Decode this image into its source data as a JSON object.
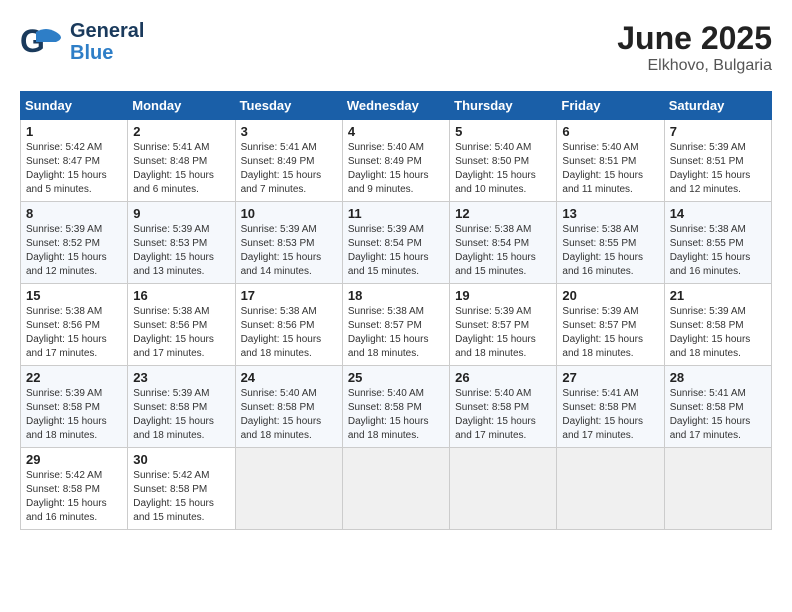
{
  "header": {
    "logo_general": "General",
    "logo_blue": "Blue",
    "month_year": "June 2025",
    "location": "Elkhovo, Bulgaria"
  },
  "calendar": {
    "days_of_week": [
      "Sunday",
      "Monday",
      "Tuesday",
      "Wednesday",
      "Thursday",
      "Friday",
      "Saturday"
    ],
    "weeks": [
      [
        {
          "day": "1",
          "info": "Sunrise: 5:42 AM\nSunset: 8:47 PM\nDaylight: 15 hours\nand 5 minutes."
        },
        {
          "day": "2",
          "info": "Sunrise: 5:41 AM\nSunset: 8:48 PM\nDaylight: 15 hours\nand 6 minutes."
        },
        {
          "day": "3",
          "info": "Sunrise: 5:41 AM\nSunset: 8:49 PM\nDaylight: 15 hours\nand 7 minutes."
        },
        {
          "day": "4",
          "info": "Sunrise: 5:40 AM\nSunset: 8:49 PM\nDaylight: 15 hours\nand 9 minutes."
        },
        {
          "day": "5",
          "info": "Sunrise: 5:40 AM\nSunset: 8:50 PM\nDaylight: 15 hours\nand 10 minutes."
        },
        {
          "day": "6",
          "info": "Sunrise: 5:40 AM\nSunset: 8:51 PM\nDaylight: 15 hours\nand 11 minutes."
        },
        {
          "day": "7",
          "info": "Sunrise: 5:39 AM\nSunset: 8:51 PM\nDaylight: 15 hours\nand 12 minutes."
        }
      ],
      [
        {
          "day": "8",
          "info": "Sunrise: 5:39 AM\nSunset: 8:52 PM\nDaylight: 15 hours\nand 12 minutes."
        },
        {
          "day": "9",
          "info": "Sunrise: 5:39 AM\nSunset: 8:53 PM\nDaylight: 15 hours\nand 13 minutes."
        },
        {
          "day": "10",
          "info": "Sunrise: 5:39 AM\nSunset: 8:53 PM\nDaylight: 15 hours\nand 14 minutes."
        },
        {
          "day": "11",
          "info": "Sunrise: 5:39 AM\nSunset: 8:54 PM\nDaylight: 15 hours\nand 15 minutes."
        },
        {
          "day": "12",
          "info": "Sunrise: 5:38 AM\nSunset: 8:54 PM\nDaylight: 15 hours\nand 15 minutes."
        },
        {
          "day": "13",
          "info": "Sunrise: 5:38 AM\nSunset: 8:55 PM\nDaylight: 15 hours\nand 16 minutes."
        },
        {
          "day": "14",
          "info": "Sunrise: 5:38 AM\nSunset: 8:55 PM\nDaylight: 15 hours\nand 16 minutes."
        }
      ],
      [
        {
          "day": "15",
          "info": "Sunrise: 5:38 AM\nSunset: 8:56 PM\nDaylight: 15 hours\nand 17 minutes."
        },
        {
          "day": "16",
          "info": "Sunrise: 5:38 AM\nSunset: 8:56 PM\nDaylight: 15 hours\nand 17 minutes."
        },
        {
          "day": "17",
          "info": "Sunrise: 5:38 AM\nSunset: 8:56 PM\nDaylight: 15 hours\nand 18 minutes."
        },
        {
          "day": "18",
          "info": "Sunrise: 5:38 AM\nSunset: 8:57 PM\nDaylight: 15 hours\nand 18 minutes."
        },
        {
          "day": "19",
          "info": "Sunrise: 5:39 AM\nSunset: 8:57 PM\nDaylight: 15 hours\nand 18 minutes."
        },
        {
          "day": "20",
          "info": "Sunrise: 5:39 AM\nSunset: 8:57 PM\nDaylight: 15 hours\nand 18 minutes."
        },
        {
          "day": "21",
          "info": "Sunrise: 5:39 AM\nSunset: 8:58 PM\nDaylight: 15 hours\nand 18 minutes."
        }
      ],
      [
        {
          "day": "22",
          "info": "Sunrise: 5:39 AM\nSunset: 8:58 PM\nDaylight: 15 hours\nand 18 minutes."
        },
        {
          "day": "23",
          "info": "Sunrise: 5:39 AM\nSunset: 8:58 PM\nDaylight: 15 hours\nand 18 minutes."
        },
        {
          "day": "24",
          "info": "Sunrise: 5:40 AM\nSunset: 8:58 PM\nDaylight: 15 hours\nand 18 minutes."
        },
        {
          "day": "25",
          "info": "Sunrise: 5:40 AM\nSunset: 8:58 PM\nDaylight: 15 hours\nand 18 minutes."
        },
        {
          "day": "26",
          "info": "Sunrise: 5:40 AM\nSunset: 8:58 PM\nDaylight: 15 hours\nand 17 minutes."
        },
        {
          "day": "27",
          "info": "Sunrise: 5:41 AM\nSunset: 8:58 PM\nDaylight: 15 hours\nand 17 minutes."
        },
        {
          "day": "28",
          "info": "Sunrise: 5:41 AM\nSunset: 8:58 PM\nDaylight: 15 hours\nand 17 minutes."
        }
      ],
      [
        {
          "day": "29",
          "info": "Sunrise: 5:42 AM\nSunset: 8:58 PM\nDaylight: 15 hours\nand 16 minutes."
        },
        {
          "day": "30",
          "info": "Sunrise: 5:42 AM\nSunset: 8:58 PM\nDaylight: 15 hours\nand 15 minutes."
        },
        {
          "day": "",
          "info": ""
        },
        {
          "day": "",
          "info": ""
        },
        {
          "day": "",
          "info": ""
        },
        {
          "day": "",
          "info": ""
        },
        {
          "day": "",
          "info": ""
        }
      ]
    ]
  }
}
